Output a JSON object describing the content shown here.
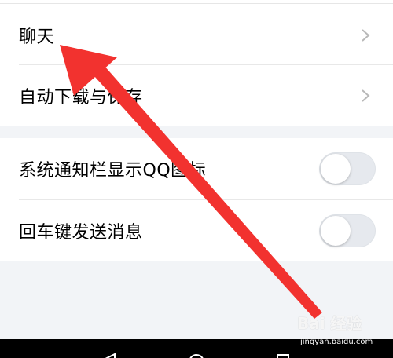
{
  "settings": {
    "group1": [
      {
        "label": "聊天"
      },
      {
        "label": "自动下载与保存"
      }
    ],
    "group2": [
      {
        "label": "系统通知栏显示QQ图标",
        "enabled": false
      },
      {
        "label": "回车键发送消息",
        "enabled": false
      }
    ]
  },
  "watermark": {
    "logo": "Bai 经验",
    "url": "jingyan.baidu.com"
  },
  "colors": {
    "annotation_arrow": "#f2322f",
    "toggle_off": "#e6e9ee"
  },
  "icons": [
    "chevron-right-icon",
    "nav-back-icon",
    "nav-home-icon",
    "nav-recents-icon"
  ]
}
